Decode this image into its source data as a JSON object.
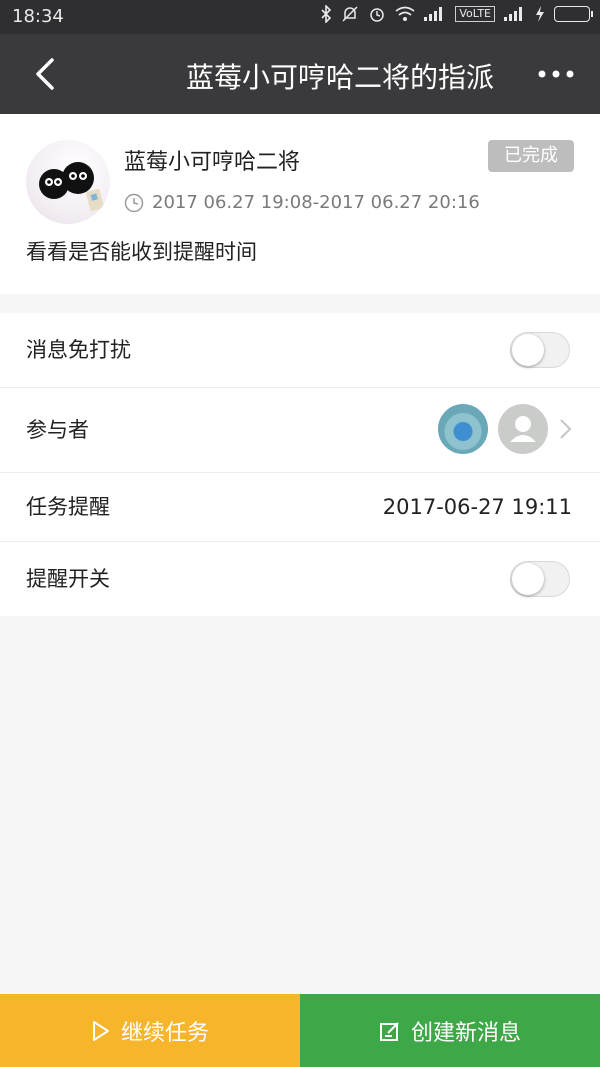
{
  "status_bar": {
    "time": "18:34",
    "network_label": "VoLTE",
    "icons": [
      "bluetooth-icon",
      "mute-icon",
      "alarm-icon",
      "wifi-icon",
      "signal-icon",
      "charging-icon",
      "battery-icon"
    ]
  },
  "navbar": {
    "title": "蓝莓小可哼哈二将的指派",
    "back_icon": "chevron-left-icon",
    "more_icon": "more-dots-icon"
  },
  "task": {
    "creator": "蓝莓小可哼哈二将",
    "status": "已完成",
    "time_range": "2017 06.27 19:08-2017 06.27 20:16",
    "description": "看看是否能收到提醒时间"
  },
  "settings": {
    "dnd_label": "消息免打扰",
    "dnd_on": false,
    "participants_label": "参与者",
    "reminder_label": "任务提醒",
    "reminder_value": "2017-06-27 19:11",
    "reminder_switch_label": "提醒开关",
    "reminder_switch_on": false
  },
  "actions": {
    "continue_label": "继续任务",
    "new_message_label": "创建新消息"
  },
  "colors": {
    "navbar": "#3a3a3c",
    "continue": "#f7b52c",
    "new_message": "#3ea849",
    "badge": "#bdbdbd"
  }
}
